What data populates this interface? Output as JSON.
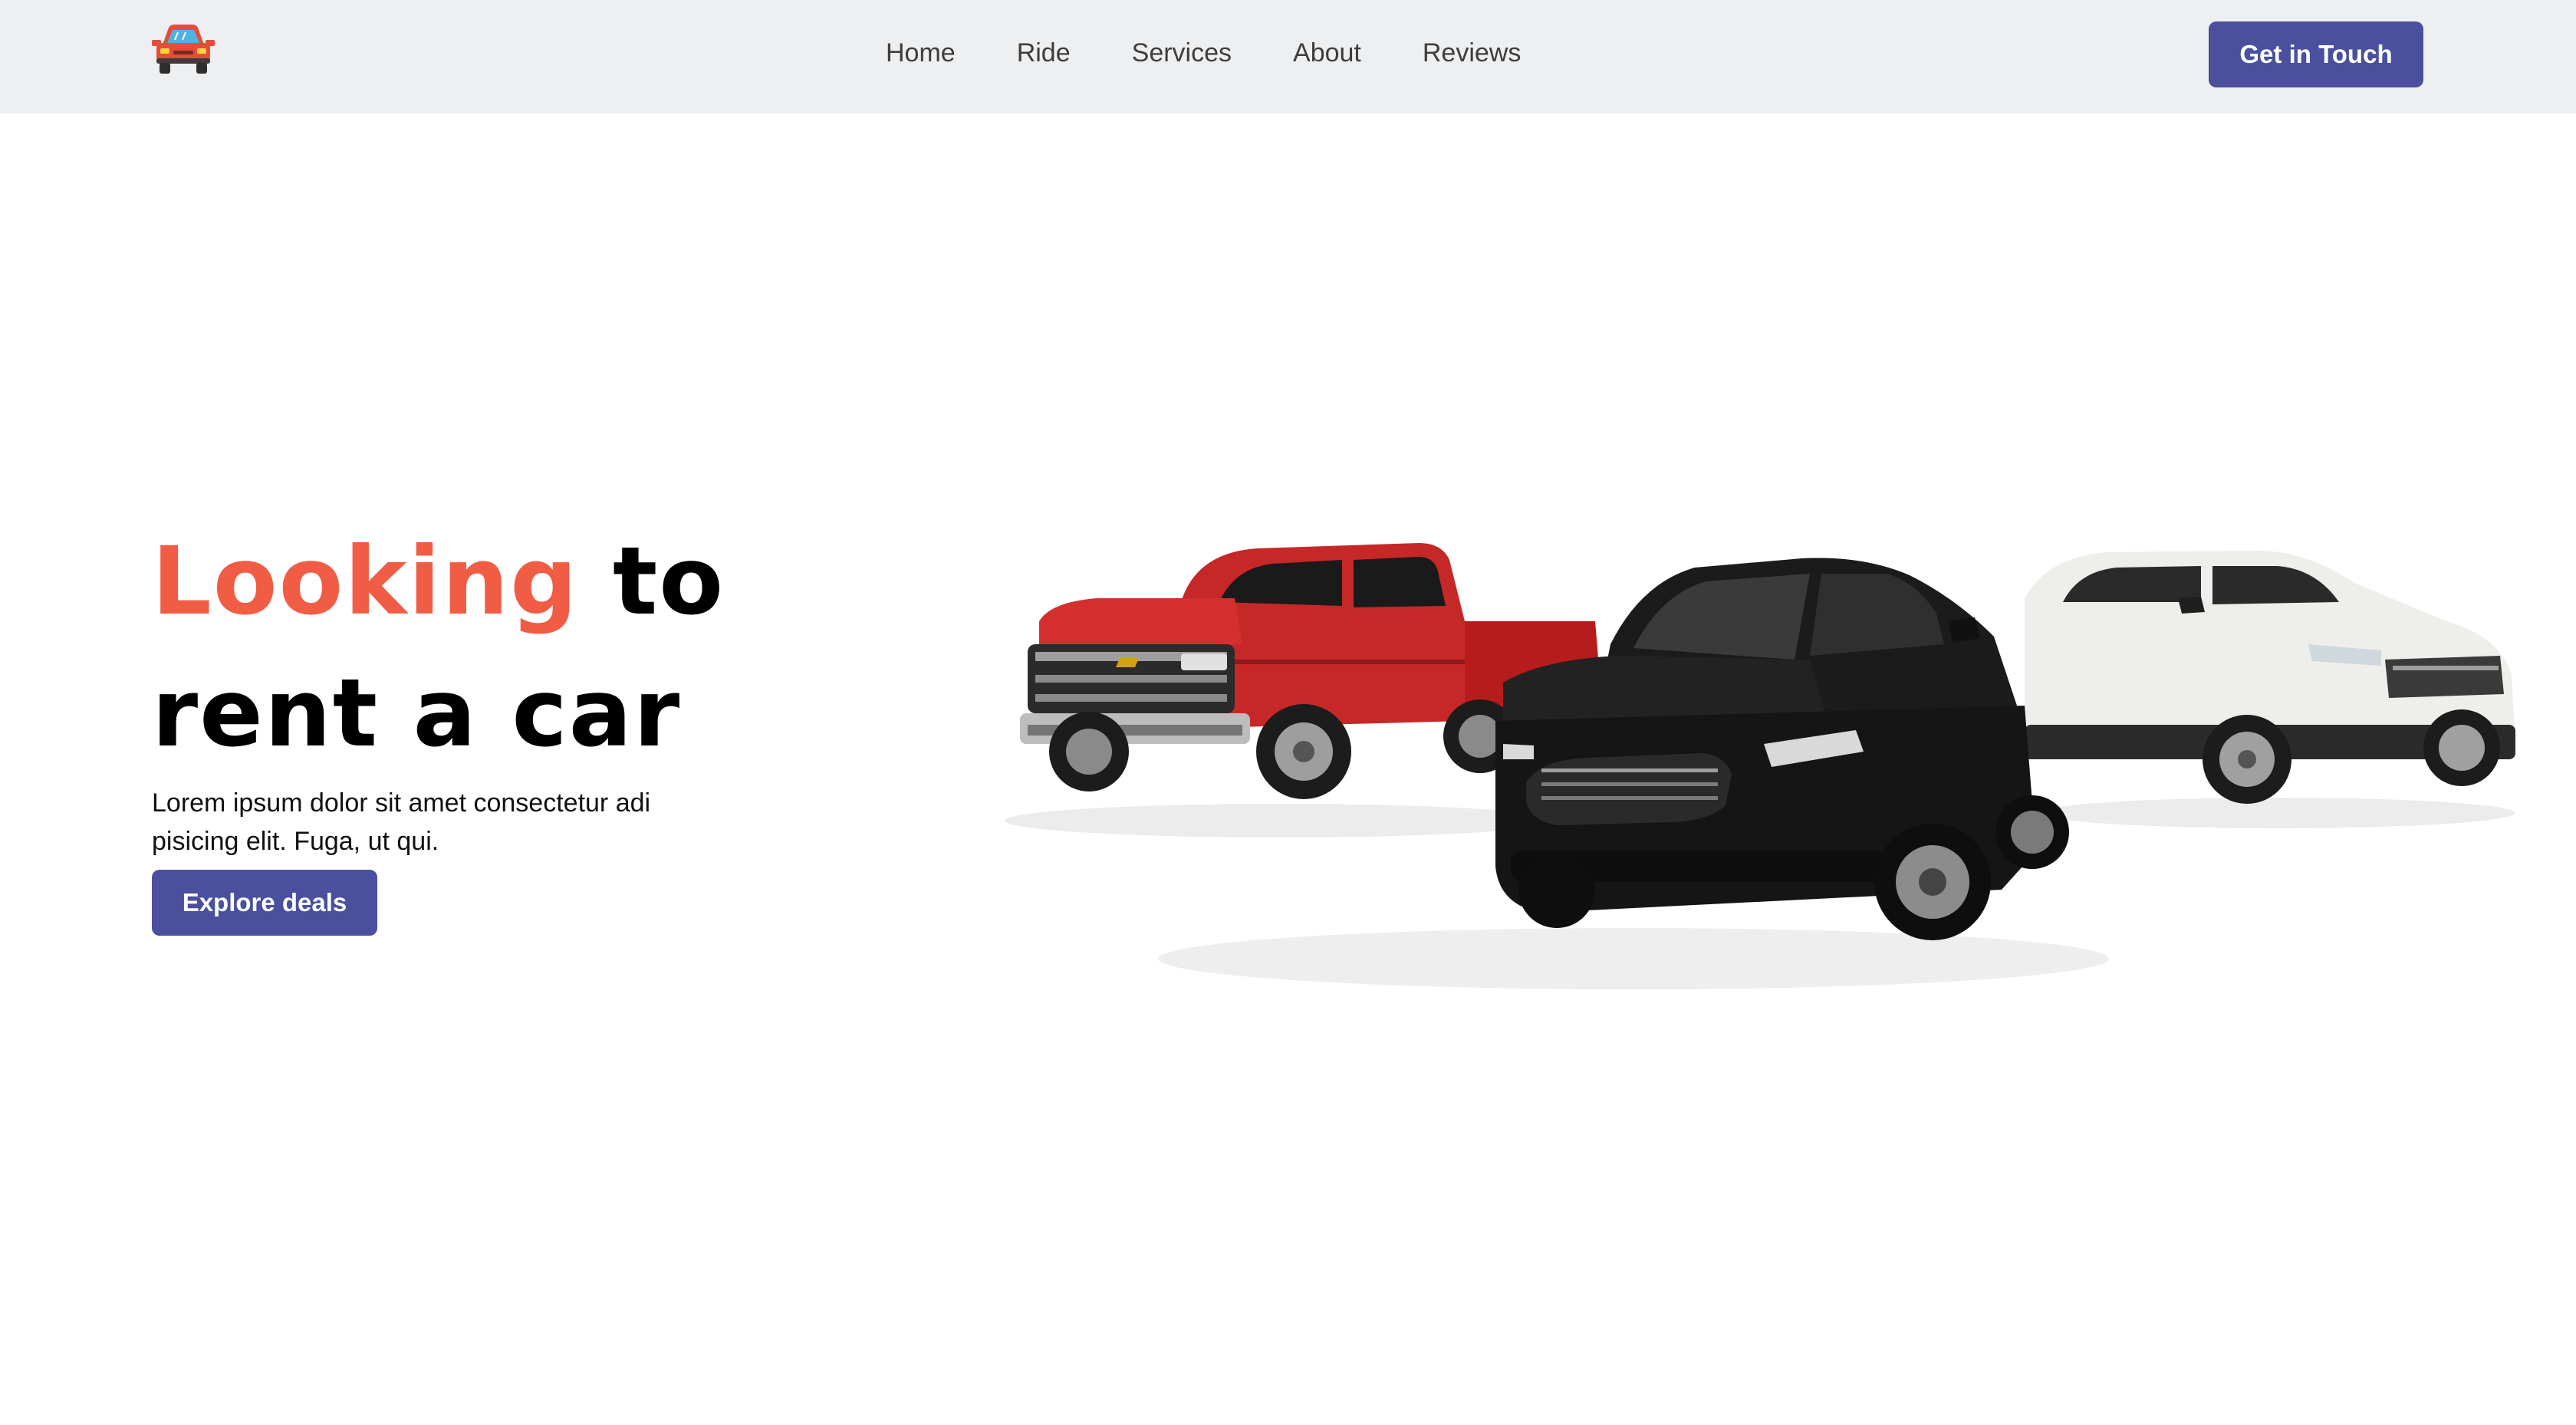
{
  "brand": {
    "logo_icon": "red-car-icon",
    "accent_color": "#f15c45",
    "button_color": "#4a4f9e"
  },
  "nav": {
    "items": [
      {
        "label": "Home"
      },
      {
        "label": "Ride"
      },
      {
        "label": "Services"
      },
      {
        "label": "About"
      },
      {
        "label": "Reviews"
      }
    ],
    "cta_label": "Get in Touch"
  },
  "hero": {
    "title_accent": "Looking",
    "title_rest_1": " to",
    "title_rest_2": "rent a car",
    "description": "Lorem ipsum dolor sit amet consectetur adi pisicing elit. Fuga, ut qui.",
    "cta_label": "Explore deals",
    "image_icon": "three-cars-image"
  }
}
